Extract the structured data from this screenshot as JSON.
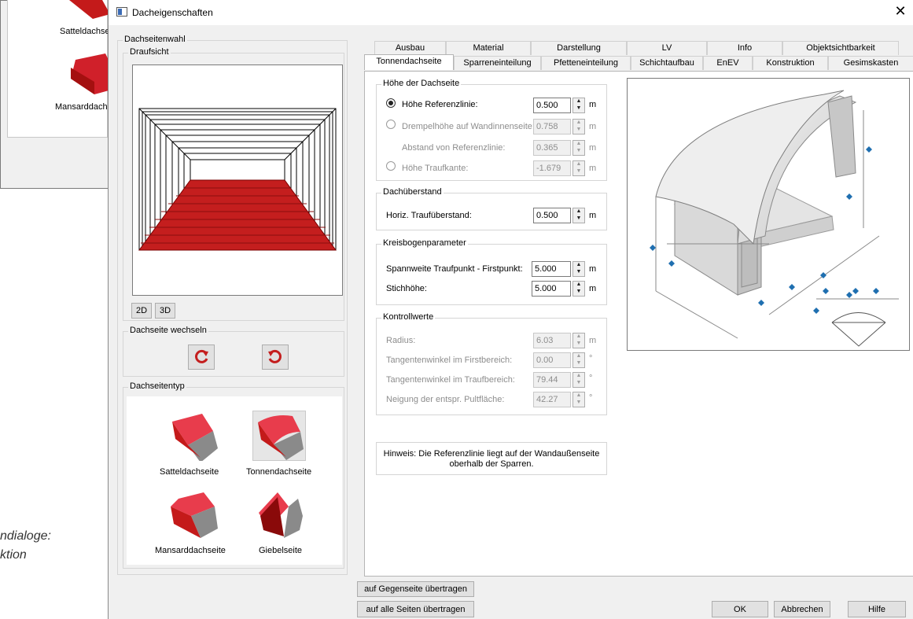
{
  "background": {
    "label_top": "Satteldachse",
    "label_bottom": "Mansarddachs",
    "side_text_1": "ndialoge:",
    "side_text_2": "ktion"
  },
  "dialog": {
    "title": "Dacheigenschaften",
    "close_glyph": "✕"
  },
  "left": {
    "group_title": "Dachseitenwahl",
    "draufsicht_title": "Draufsicht",
    "btn_2d": "2D",
    "btn_3d": "3D",
    "switch_title": "Dachseite wechseln",
    "type_title": "Dachseitentyp",
    "types": [
      {
        "label": "Satteldachseite"
      },
      {
        "label": "Tonnendachseite"
      },
      {
        "label": "Mansarddachseite"
      },
      {
        "label": "Giebelseite"
      }
    ]
  },
  "tabs": {
    "row1": [
      "Ausbau",
      "Material",
      "Darstellung",
      "LV",
      "Info",
      "Objektsichtbarkeit"
    ],
    "row2": [
      "Tonnendachseite",
      "Sparreneinteilung",
      "Pfetteneinteilung",
      "Schichtaufbau",
      "EnEV",
      "Konstruktion",
      "Gesimskasten"
    ]
  },
  "hoehe": {
    "title": "Höhe der Dachseite",
    "ref_label": "Höhe Referenzlinie:",
    "ref_value": "0.500",
    "drempel_label": "Drempelhöhe auf Wandinnenseite:",
    "drempel_value": "0.758",
    "abstand_label": "Abstand von Referenzlinie:",
    "abstand_value": "0.365",
    "traufkante_label": "Höhe Traufkante:",
    "traufkante_value": "-1.679",
    "unit": "m"
  },
  "ueberstand": {
    "title": "Dachüberstand",
    "label": "Horiz. Traufüberstand:",
    "value": "0.500",
    "unit": "m"
  },
  "kreis": {
    "title": "Kreisbogenparameter",
    "spann_label": "Spannweite Traufpunkt - Firstpunkt:",
    "spann_value": "5.000",
    "stich_label": "Stichhöhe:",
    "stich_value": "5.000",
    "unit": "m"
  },
  "kontroll": {
    "title": "Kontrollwerte",
    "radius_label": "Radius:",
    "radius_value": "6.03",
    "radius_unit": "m",
    "first_label": "Tangentenwinkel im Firstbereich:",
    "first_value": "0.00",
    "trauf_label": "Tangentenwinkel im Traufbereich:",
    "trauf_value": "79.44",
    "neig_label": "Neigung der entspr. Pultfläche:",
    "neig_value": "42.27",
    "deg_unit": "°"
  },
  "hinweis": {
    "line1": "Hinweis: Die Referenzlinie liegt auf der Wandaußenseite",
    "line2": "oberhalb der Sparren."
  },
  "bottom": {
    "gegenseite": "auf Gegenseite übertragen",
    "alle": "auf alle Seiten übertragen",
    "ok": "OK",
    "abbrechen": "Abbrechen",
    "hilfe": "Hilfe"
  },
  "colors": {
    "roof_red": "#cc1f1f",
    "roof_light": "#e84a5a",
    "accent_blue": "#1f6fb0"
  }
}
